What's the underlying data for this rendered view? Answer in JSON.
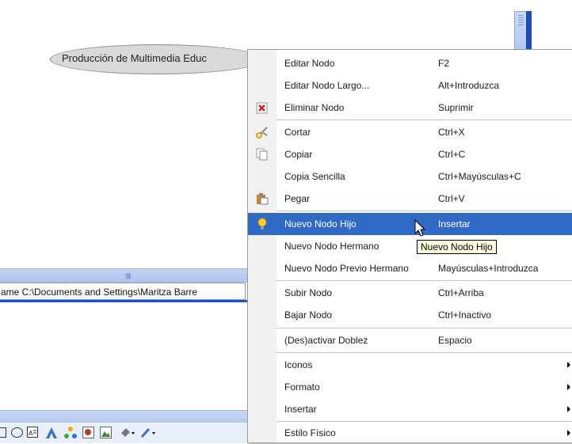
{
  "node": {
    "label": "Producción de Multimedia Educ"
  },
  "status_bar": {
    "text": "ame C:\\Documents and Settings\\Maritza Barre"
  },
  "context_menu": {
    "items": [
      {
        "label": "Editar Nodo",
        "shortcut": "F2",
        "icon": null
      },
      {
        "label": "Editar Nodo Largo...",
        "shortcut": "Alt+Introduzca",
        "icon": null
      },
      {
        "label": "Eliminar Nodo",
        "shortcut": "Suprimir",
        "icon": "delete-icon"
      },
      {
        "label": "Cortar",
        "shortcut": "Ctrl+X",
        "icon": "scissors-icon"
      },
      {
        "label": "Copiar",
        "shortcut": "Ctrl+C",
        "icon": "copy-icon"
      },
      {
        "label": "Copia Sencilla",
        "shortcut": "Ctrl+Mayúsculas+C",
        "icon": null
      },
      {
        "label": "Pegar",
        "shortcut": "Ctrl+V",
        "icon": "paste-icon"
      },
      {
        "label": "Nuevo Nodo Hijo",
        "shortcut": "Insertar",
        "icon": "lightbulb-icon",
        "selected": true
      },
      {
        "label": "Nuevo Nodo Hermano",
        "shortcut": "",
        "icon": null
      },
      {
        "label": "Nuevo Nodo Previo Hermano",
        "shortcut": "Mayúsculas+Introduzca",
        "icon": null
      },
      {
        "label": "Subir Nodo",
        "shortcut": "Ctrl+Arriba",
        "icon": null
      },
      {
        "label": "Bajar Nodo",
        "shortcut": "Ctrl+Inactivo",
        "icon": null
      },
      {
        "label": "(Des)activar Doblez",
        "shortcut": "Espacio",
        "icon": null
      },
      {
        "label": "Iconos",
        "shortcut": "",
        "submenu": true
      },
      {
        "label": "Formato",
        "shortcut": "",
        "submenu": true
      },
      {
        "label": "Insertar",
        "shortcut": "",
        "submenu": true
      },
      {
        "label": "Estilo Físico",
        "shortcut": "",
        "submenu": true
      }
    ]
  },
  "tooltip": {
    "text": "Nuevo Nodo Hijo"
  },
  "colors": {
    "selection": "#316ac5",
    "tooltip_bg": "#ffffe1",
    "node_fill": "#d9d9d9"
  }
}
